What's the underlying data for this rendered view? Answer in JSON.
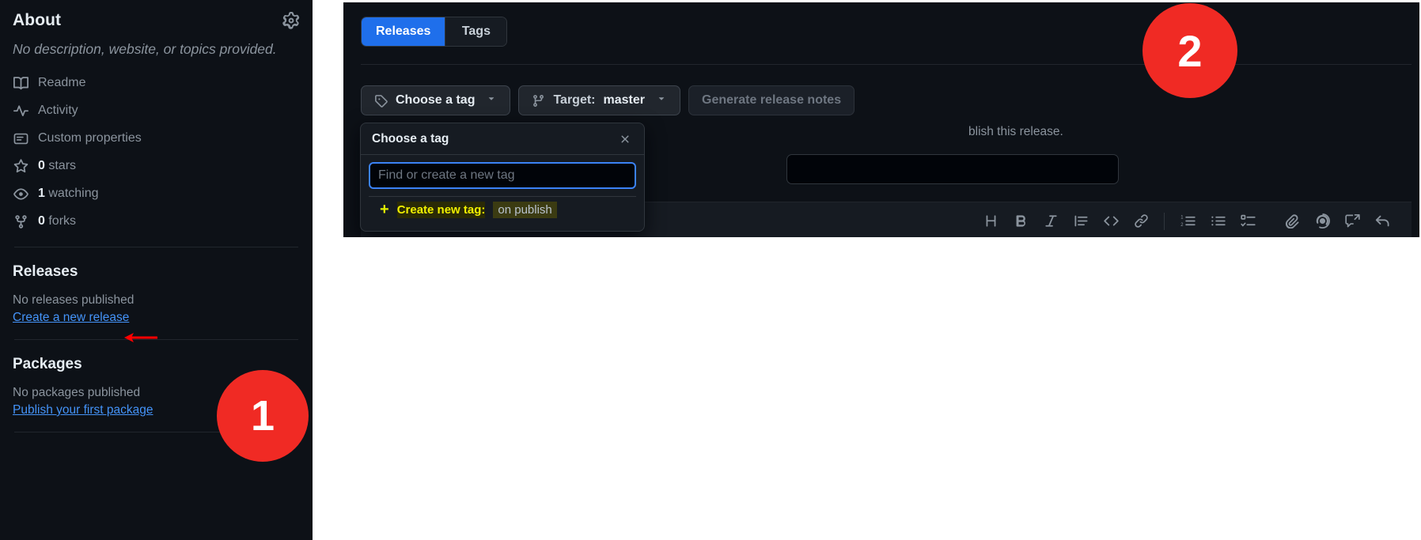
{
  "sidebar": {
    "title": "About",
    "settings_icon": "gear-icon",
    "description": "No description, website, or topics provided.",
    "meta": [
      {
        "icon": "book-icon",
        "label": "Readme",
        "value": ""
      },
      {
        "icon": "pulse-icon",
        "label": "Activity",
        "value": ""
      },
      {
        "icon": "properties-icon",
        "label": "Custom properties",
        "value": ""
      },
      {
        "icon": "star-icon",
        "label": "stars",
        "value": "0"
      },
      {
        "icon": "eye-icon",
        "label": "watching",
        "value": "1"
      },
      {
        "icon": "fork-icon",
        "label": "forks",
        "value": "0"
      }
    ],
    "releases": {
      "heading": "Releases",
      "empty_text": "No releases published",
      "link": "Create a new release"
    },
    "packages": {
      "heading": "Packages",
      "empty_text": "No packages published",
      "link": "Publish your first package"
    }
  },
  "annotations": {
    "badge_1": "1",
    "badge_2": "2",
    "arrow_color": "#ff0000",
    "badge_color": "#f02a24"
  },
  "panel": {
    "tabs": [
      {
        "label": "Releases",
        "active": true
      },
      {
        "label": "Tags",
        "active": false
      }
    ],
    "choose_tag_button": "Choose a tag",
    "target_button": {
      "label": "Target:",
      "value": "master"
    },
    "generate_notes_button": "Generate release notes",
    "hint_text": "blish this release.",
    "title_placeholder": "",
    "toolbar": [
      {
        "icon": "heading-icon",
        "label": "H"
      },
      {
        "icon": "bold-icon",
        "label": "B"
      },
      {
        "icon": "italic-icon",
        "label": "I"
      },
      {
        "icon": "quote-icon",
        "label": ""
      },
      {
        "icon": "code-icon",
        "label": "<>"
      },
      {
        "icon": "link-icon",
        "label": ""
      },
      {
        "icon": "ordered-list-icon",
        "label": ""
      },
      {
        "icon": "unordered-list-icon",
        "label": ""
      },
      {
        "icon": "task-list-icon",
        "label": ""
      },
      {
        "icon": "attach-file-icon",
        "label": ""
      },
      {
        "icon": "mention-icon",
        "label": "@"
      },
      {
        "icon": "saved-reply-icon",
        "label": ""
      },
      {
        "icon": "undo-icon",
        "label": ""
      }
    ]
  },
  "popover": {
    "title": "Choose a tag",
    "close_icon": "close-icon",
    "input_placeholder": "Find or create a new tag",
    "input_value": "",
    "create_label": "Create new tag:",
    "create_value": "on publish",
    "plus_icon": "plus-icon"
  }
}
